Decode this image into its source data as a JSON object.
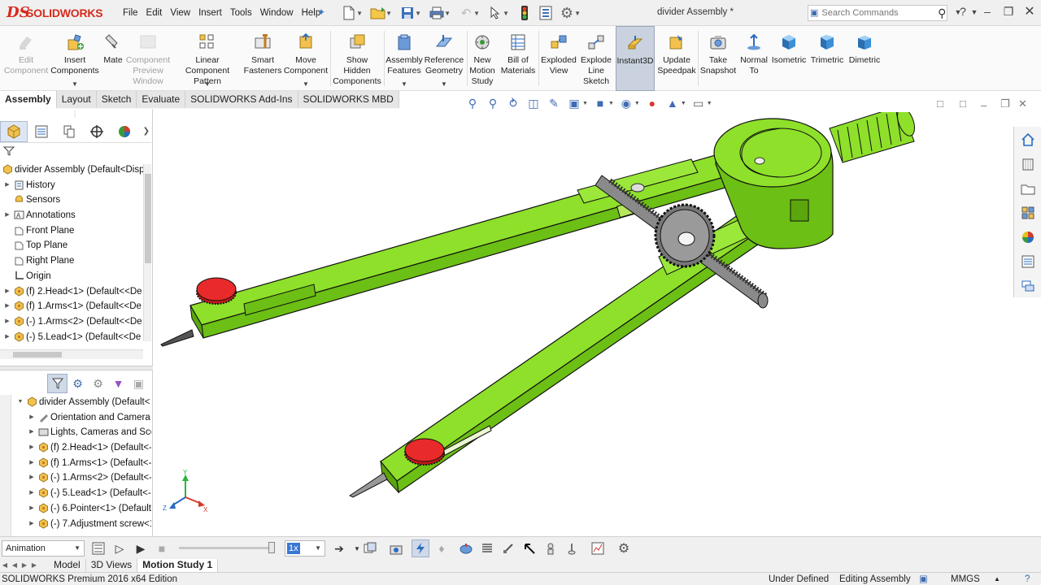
{
  "app": {
    "brand": "SOLIDWORKS",
    "brand_mark": "DS",
    "document_title": "divider Assembly *"
  },
  "menu": [
    "File",
    "Edit",
    "View",
    "Insert",
    "Tools",
    "Window",
    "Help"
  ],
  "search": {
    "placeholder": "Search Commands"
  },
  "commands": [
    {
      "label": "Edit\nComponent",
      "icon": "edit-component-icon",
      "enabled": false
    },
    {
      "label": "Insert\nComponents",
      "icon": "insert-components-icon",
      "enabled": true
    },
    {
      "label": "Mate",
      "icon": "mate-icon",
      "enabled": true
    },
    {
      "label": "Component\nPreview\nWindow",
      "icon": "component-preview-icon",
      "enabled": false
    },
    {
      "label": "Linear Component\nPattern",
      "icon": "linear-pattern-icon",
      "enabled": true
    },
    {
      "label": "Smart\nFasteners",
      "icon": "smart-fasteners-icon",
      "enabled": true
    },
    {
      "label": "Move\nComponent",
      "icon": "move-component-icon",
      "enabled": true
    },
    {
      "label": "Show\nHidden\nComponents",
      "icon": "show-hidden-icon",
      "enabled": true
    },
    {
      "label": "Assembly\nFeatures",
      "icon": "assembly-features-icon",
      "enabled": true
    },
    {
      "label": "Reference\nGeometry",
      "icon": "reference-geometry-icon",
      "enabled": true
    },
    {
      "label": "New\nMotion\nStudy",
      "icon": "motion-study-icon",
      "enabled": true
    },
    {
      "label": "Bill of\nMaterials",
      "icon": "bom-icon",
      "enabled": true
    },
    {
      "label": "Exploded\nView",
      "icon": "exploded-view-icon",
      "enabled": true
    },
    {
      "label": "Explode\nLine\nSketch",
      "icon": "explode-line-icon",
      "enabled": true
    },
    {
      "label": "Instant3D",
      "icon": "instant3d-icon",
      "enabled": true
    },
    {
      "label": "Update\nSpeedpak",
      "icon": "speedpak-icon",
      "enabled": true
    },
    {
      "label": "Take\nSnapshot",
      "icon": "snapshot-icon",
      "enabled": true
    },
    {
      "label": "Normal\nTo",
      "icon": "normal-to-icon",
      "enabled": true
    },
    {
      "label": "Isometric",
      "icon": "isometric-icon",
      "enabled": true
    },
    {
      "label": "Trimetric",
      "icon": "trimetric-icon",
      "enabled": true
    },
    {
      "label": "Dimetric",
      "icon": "dimetric-icon",
      "enabled": true
    }
  ],
  "tabs": [
    "Assembly",
    "Layout",
    "Sketch",
    "Evaluate",
    "SOLIDWORKS Add-Ins",
    "SOLIDWORKS MBD"
  ],
  "feature_tree": [
    {
      "label": "divider Assembly  (Default<Displ",
      "icon": "assembly-icon",
      "level": 0,
      "expander": false
    },
    {
      "label": "History",
      "icon": "history-icon",
      "level": 1,
      "expander": true
    },
    {
      "label": "Sensors",
      "icon": "sensors-icon",
      "level": 1,
      "expander": false
    },
    {
      "label": "Annotations",
      "icon": "annotations-icon",
      "level": 1,
      "expander": true
    },
    {
      "label": "Front Plane",
      "icon": "plane-icon",
      "level": 1,
      "expander": false
    },
    {
      "label": "Top Plane",
      "icon": "plane-icon",
      "level": 1,
      "expander": false
    },
    {
      "label": "Right Plane",
      "icon": "plane-icon",
      "level": 1,
      "expander": false
    },
    {
      "label": "Origin",
      "icon": "origin-icon",
      "level": 1,
      "expander": false
    },
    {
      "label": "(f) 2.Head<1>  (Default<<De",
      "icon": "part-icon",
      "level": 1,
      "expander": true
    },
    {
      "label": "(f) 1.Arms<1>  (Default<<De",
      "icon": "part-icon",
      "level": 1,
      "expander": true
    },
    {
      "label": "(-) 1.Arms<2>  (Default<<De",
      "icon": "part-icon",
      "level": 1,
      "expander": true
    },
    {
      "label": "(-) 5.Lead<1>  (Default<<De",
      "icon": "part-icon",
      "level": 1,
      "expander": true
    }
  ],
  "motion_tree": [
    {
      "label": "divider Assembly  (Default<",
      "icon": "assembly-icon",
      "level": 0
    },
    {
      "label": "Orientation and Camera",
      "icon": "camera-icon",
      "level": 1
    },
    {
      "label": "Lights, Cameras and Scen",
      "icon": "lights-icon",
      "level": 1
    },
    {
      "label": "(f) 2.Head<1>  (Default<-",
      "icon": "part-icon",
      "level": 1
    },
    {
      "label": "(f) 1.Arms<1>  (Default<-",
      "icon": "part-icon",
      "level": 1
    },
    {
      "label": "(-) 1.Arms<2>  (Default<-",
      "icon": "part-icon",
      "level": 1
    },
    {
      "label": "(-) 5.Lead<1>  (Default<-",
      "icon": "part-icon",
      "level": 1
    },
    {
      "label": "(-) 6.Pointer<1>  (Default",
      "icon": "part-icon",
      "level": 1
    },
    {
      "label": "(-) 7.Adjustment screw<1",
      "icon": "part-icon",
      "level": 1
    }
  ],
  "motion": {
    "study_type": "Animation",
    "playback_speed": "1x"
  },
  "bottom_tabs": [
    "Model",
    "3D Views",
    "Motion Study 1"
  ],
  "status": {
    "edition": "SOLIDWORKS Premium 2016 x64 Edition",
    "definition": "Under Defined",
    "mode": "Editing Assembly",
    "units": "MMGS"
  },
  "triad": {
    "x": "X",
    "y": "Y",
    "z": "Z"
  },
  "colors": {
    "model_green": "#8ee02a",
    "knob_red": "#e82a2a",
    "accent_blue": "#3f6bb3",
    "brand_red": "#d52b1e"
  }
}
